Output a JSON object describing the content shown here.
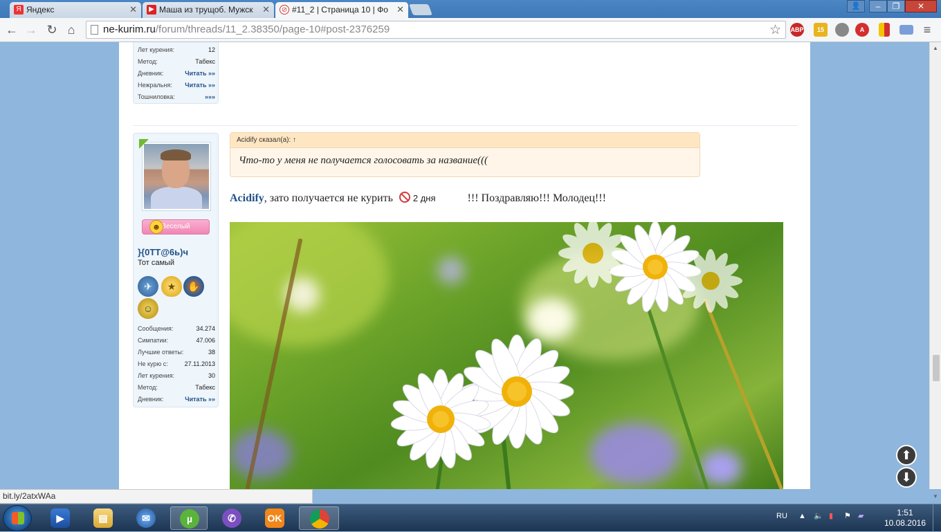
{
  "browser": {
    "tabs": [
      {
        "title": "Яндекс",
        "icon": "Я",
        "color": "#e33"
      },
      {
        "title": "Маша из трущоб. Мужск",
        "icon": "▶",
        "color": "#d22"
      },
      {
        "title": "#11_2 | Страница 10 | Фо",
        "icon": "⊘",
        "color": "#c33"
      }
    ],
    "url_domain": "ne-kurim.ru",
    "url_path": "/forum/threads/11_2.38350/page-10#post-2376259",
    "extensions": [
      "ABP",
      "15",
      "",
      "A",
      "",
      ""
    ]
  },
  "prev_post": {
    "stats": [
      {
        "label": "Лет курения:",
        "value": "12",
        "link": false
      },
      {
        "label": "Метод:",
        "value": "Табекс",
        "link": false
      },
      {
        "label": "Дневник:",
        "value": "Читать »»",
        "link": true
      },
      {
        "label": "Нежральня:",
        "value": "Читать »»",
        "link": true
      },
      {
        "label": "Тошниловка:",
        "value": "»»»",
        "link": true
      }
    ]
  },
  "post": {
    "mood": "Веселый",
    "username": "}{0ТТ@6ь)ч",
    "user_title": "Тот самый",
    "stats": [
      {
        "label": "Сообщения:",
        "value": "34.274",
        "link": false
      },
      {
        "label": "Симпатии:",
        "value": "47.006",
        "link": false
      },
      {
        "label": "Лучшие ответы:",
        "value": "38",
        "link": false
      },
      {
        "label": "Не курю с:",
        "value": "27.11.2013",
        "link": false
      },
      {
        "label": "Лет курения:",
        "value": "30",
        "link": false
      },
      {
        "label": "Метод:",
        "value": "Табекс",
        "link": false
      },
      {
        "label": "Дневник:",
        "value": "Читать »»",
        "link": true
      }
    ],
    "quote_author": "Acidify сказал(а): ↑",
    "quote_text": "Что-то у меня не получается голосовать за название(((",
    "message_name": "Acidify",
    "message_part1": ", зато получается не курить",
    "message_days": "2 дня",
    "message_part2": "!!! Поздравляю!!! Молодец!!!"
  },
  "status_url": "bit.ly/2atxWAa",
  "taskbar": {
    "lang": "RU",
    "time": "1:51",
    "date": "10.08.2016"
  }
}
